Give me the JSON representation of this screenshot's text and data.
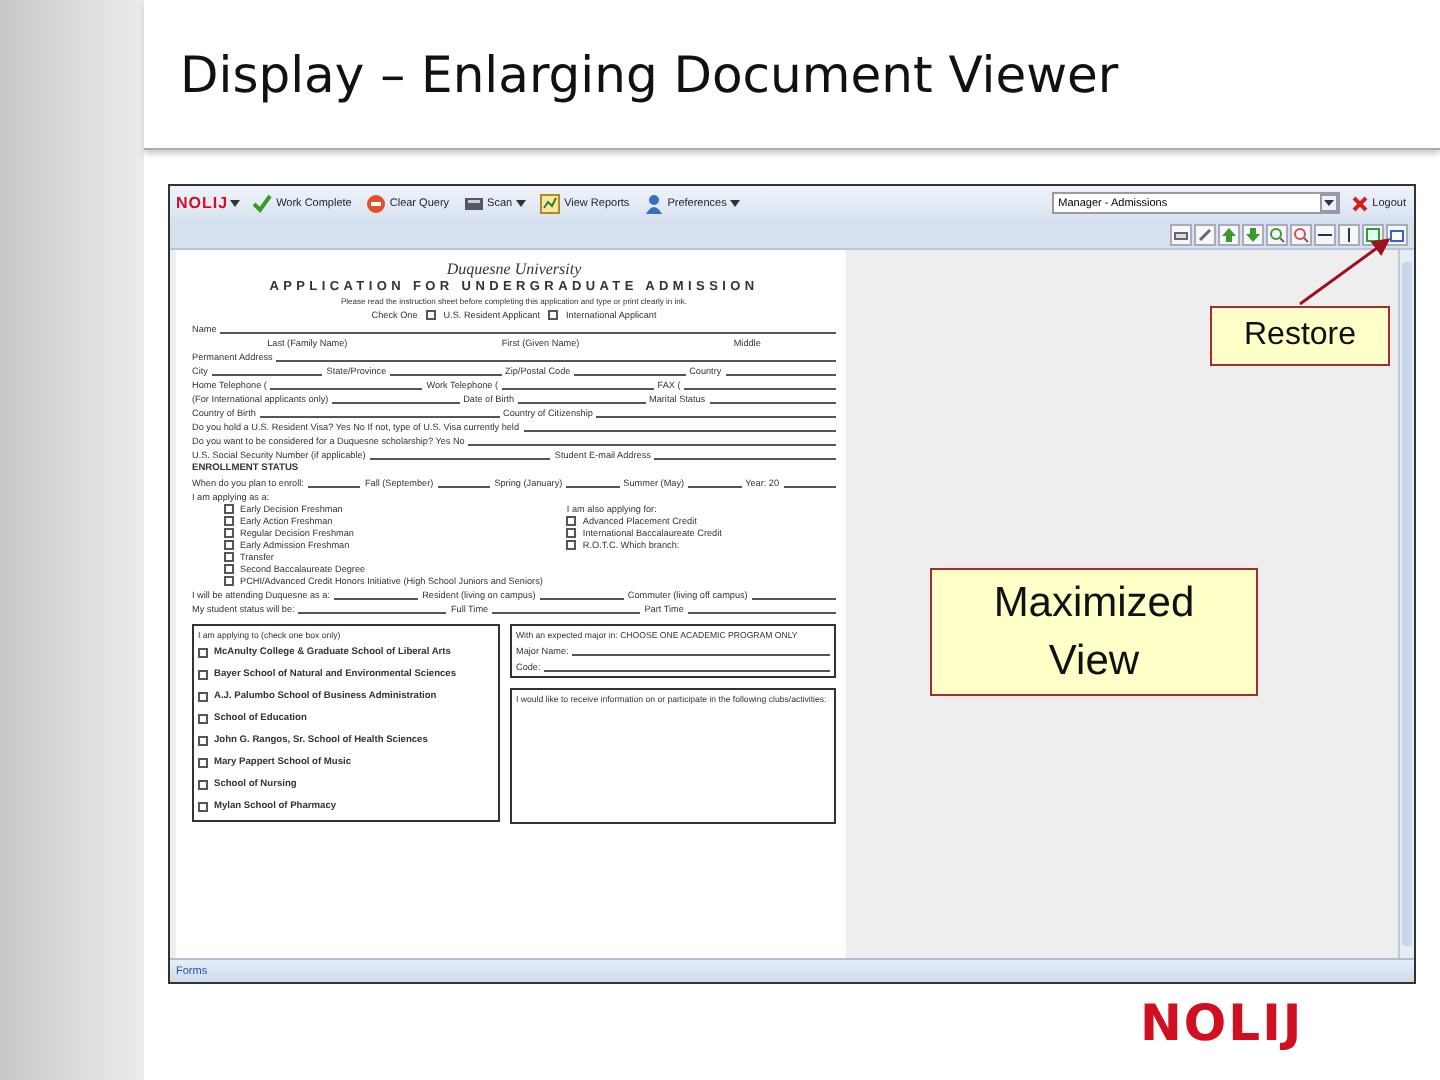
{
  "slide": {
    "title": "Display – Enlarging Document Viewer",
    "logo": "NOLIJ"
  },
  "app": {
    "logo": "NOLIJ",
    "toolbar": [
      {
        "kind": "check",
        "label": "Work Complete",
        "dropdown": false
      },
      {
        "kind": "stop",
        "label": "Clear Query",
        "dropdown": false
      },
      {
        "kind": "scan",
        "label": "Scan",
        "dropdown": true
      },
      {
        "kind": "report",
        "label": "View Reports",
        "dropdown": false
      },
      {
        "kind": "prefs",
        "label": "Preferences",
        "dropdown": true
      }
    ],
    "role_select": {
      "value": "Manager - Admissions"
    },
    "logout": "Logout"
  },
  "document": {
    "university": "Duquesne University",
    "form_title": "APPLICATION FOR UNDERGRADUATE ADMISSION",
    "instructions": "Please read the instruction sheet before completing this application and type or print clearly in ink.",
    "rows": [
      {
        "kind": "check",
        "items": [
          "Check One",
          "U.S. Resident Applicant",
          "International Applicant"
        ]
      },
      {
        "kind": "fields",
        "items": [
          "Name"
        ]
      },
      {
        "kind": "captions",
        "items": [
          "Last (Family Name)",
          "First (Given Name)",
          "Middle"
        ]
      },
      {
        "kind": "fields",
        "items": [
          "Permanent Address"
        ]
      },
      {
        "kind": "fields",
        "items": [
          "City",
          "State/Province",
          "Zip/Postal Code",
          "Country"
        ]
      },
      {
        "kind": "fields",
        "items": [
          "Home Telephone (",
          "Work Telephone (",
          "FAX ("
        ]
      },
      {
        "kind": "fields",
        "items": [
          "(For International applicants only)",
          "Date of Birth",
          "Marital Status"
        ]
      },
      {
        "kind": "fields",
        "items": [
          "Country of Birth",
          "Country of Citizenship"
        ]
      },
      {
        "kind": "fields",
        "items": [
          "Do you hold a U.S. Resident Visa?  Yes  No   If not, type of U.S. Visa currently held"
        ]
      },
      {
        "kind": "fields",
        "items": [
          "Do you want to be considered for a Duquesne scholarship?  Yes   No"
        ]
      },
      {
        "kind": "fields",
        "items": [
          "U.S. Social Security Number (if applicable)",
          "Student E-mail Address"
        ]
      },
      {
        "kind": "heading",
        "items": [
          "ENROLLMENT STATUS"
        ]
      },
      {
        "kind": "fields",
        "items": [
          "When do you plan to enroll:",
          "Fall (September)",
          "Spring (January)",
          "Summer (May)",
          "Year: 20"
        ]
      },
      {
        "kind": "text",
        "items": [
          "I am applying as a:"
        ]
      },
      {
        "kind": "options",
        "columns": [
          [
            "Early Decision Freshman",
            "Early Action Freshman",
            "Regular Decision Freshman",
            "Early Admission Freshman",
            "Transfer",
            "Second Baccalaureate Degree",
            "PCHI/Advanced Credit Honors Initiative (High School Juniors and Seniors)"
          ],
          [
            "I am also applying for:",
            "Advanced Placement Credit",
            "International Baccalaureate Credit",
            "R.O.T.C.   Which branch:"
          ]
        ]
      },
      {
        "kind": "fields",
        "items": [
          "I will be attending Duquesne as a:",
          "Resident (living on campus)",
          "Commuter (living off campus)"
        ]
      },
      {
        "kind": "fields",
        "items": [
          "My student status will be:",
          "Full Time",
          "Part Time"
        ]
      }
    ],
    "schools_box": {
      "heading": "I am applying to (check one box only)",
      "items": [
        "McAnulty College & Graduate School of Liberal Arts",
        "Bayer School of Natural and Environmental Sciences",
        "A.J. Palumbo School of Business Administration",
        "School of Education",
        "John G. Rangos, Sr. School of Health Sciences",
        "Mary Pappert School of Music",
        "School of Nursing",
        "Mylan School of Pharmacy"
      ]
    },
    "major_box": {
      "heading": "With an expected major in: CHOOSE ONE ACADEMIC PROGRAM ONLY",
      "fields": [
        "Major Name:",
        "Code:"
      ]
    },
    "clubs_box": {
      "heading": "I would like to receive information on or participate in the following clubs/activities:"
    }
  },
  "status_bar": "Forms",
  "callouts": [
    {
      "text": "Restore"
    },
    {
      "text": "Maximized View"
    }
  ]
}
